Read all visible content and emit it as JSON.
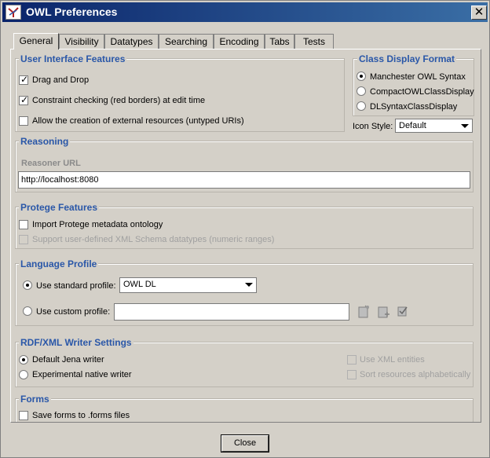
{
  "window": {
    "title": "OWL Preferences"
  },
  "tabs": [
    "General",
    "Visibility",
    "Datatypes",
    "Searching",
    "Encoding",
    "Tabs",
    "Tests"
  ],
  "ui_features": {
    "title": "User Interface Features",
    "items": [
      {
        "label": "Drag and Drop",
        "checked": true
      },
      {
        "label": "Constraint checking (red borders) at edit time",
        "checked": true
      },
      {
        "label": "Allow the creation of external resources (untyped URIs)",
        "checked": false
      }
    ]
  },
  "class_display": {
    "title": "Class Display Format",
    "options": [
      "Manchester OWL Syntax",
      "CompactOWLClassDisplay",
      "DLSyntaxClassDisplay"
    ],
    "selected": "Manchester OWL Syntax",
    "icon_style_label": "Icon Style:",
    "icon_style_value": "Default"
  },
  "reasoning": {
    "title": "Reasoning",
    "url_label": "Reasoner URL",
    "url_value": "http://localhost:8080"
  },
  "protege": {
    "title": "Protege Features",
    "items": [
      {
        "label": "Import Protege metadata ontology",
        "checked": false,
        "enabled": true
      },
      {
        "label": "Support user-defined XML Schema datatypes (numeric ranges)",
        "checked": false,
        "enabled": false
      }
    ]
  },
  "language_profile": {
    "title": "Language Profile",
    "standard_label": "Use standard profile:",
    "standard_value": "OWL DL",
    "custom_label": "Use custom profile:",
    "custom_value": "",
    "selected": "standard"
  },
  "rdf_writer": {
    "title": "RDF/XML Writer Settings",
    "options": [
      "Default Jena writer",
      "Experimental native writer"
    ],
    "selected": "Default Jena writer",
    "disabled_options": [
      "Use XML entities",
      "Sort resources alphabetically"
    ]
  },
  "forms": {
    "title": "Forms",
    "save_label": "Save forms to .forms files"
  },
  "footer": {
    "close_label": "Close"
  }
}
